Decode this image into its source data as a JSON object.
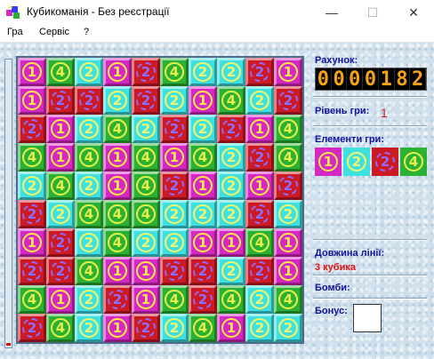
{
  "window": {
    "title": "Кубикоманія - Без реєстрації",
    "minimize": "—",
    "maximize": "☐",
    "close": "✕"
  },
  "menu": [
    "Гра",
    "Сервіс",
    "?"
  ],
  "board": [
    [
      "m1",
      "g4",
      "c2",
      "m1",
      "r2",
      "g4",
      "c2",
      "c2",
      "r2",
      "m1"
    ],
    [
      "m1",
      "r2",
      "r2",
      "c2",
      "r2",
      "c2",
      "m1",
      "g4",
      "c2",
      "r2"
    ],
    [
      "r2",
      "m1",
      "c2",
      "g4",
      "c2",
      "r2",
      "c2",
      "r2",
      "m1",
      "g4"
    ],
    [
      "g4",
      "m1",
      "g4",
      "m1",
      "g4",
      "m1",
      "g4",
      "c2",
      "r2",
      "g4"
    ],
    [
      "c2",
      "g4",
      "c2",
      "m1",
      "g4",
      "r2",
      "m1",
      "c2",
      "m1",
      "r2"
    ],
    [
      "r2",
      "c2",
      "g4",
      "g4",
      "g4",
      "c2",
      "c2",
      "c2",
      "r2",
      "c2"
    ],
    [
      "m1",
      "r2",
      "c2",
      "g4",
      "c2",
      "c2",
      "m1",
      "m1",
      "g4",
      "m1"
    ],
    [
      "r2",
      "r2",
      "g4",
      "m1",
      "m1",
      "r2",
      "r2",
      "c2",
      "r2",
      "m1"
    ],
    [
      "g4",
      "m1",
      "c2",
      "r2",
      "m1",
      "g4",
      "r2",
      "g4",
      "c2",
      "g4"
    ],
    [
      "r2",
      "g4",
      "c2",
      "m1",
      "r2",
      "c2",
      "g4",
      "m1",
      "c2",
      "c2"
    ]
  ],
  "panel": {
    "score_label": "Рахунок:",
    "score_value": "0000182",
    "level_label": "Рівень гри:",
    "level_value": "1",
    "elements_label": "Елементи гри:",
    "elements": [
      "m1",
      "c2",
      "r2",
      "g4"
    ],
    "line_length_label": "Довжина лінії:",
    "line_length_value": "3 кубика",
    "bombs_label": "Бомби:",
    "bonus_label": "Бонус:"
  },
  "progress_level": 0.01,
  "colors": {
    "m": "#d629c4",
    "c": "#3fe0e0",
    "r": "#cc1a24",
    "g": "#2bb234",
    "label": "#12129a",
    "alert": "#e01010",
    "score_digits": "#f5a21a"
  }
}
